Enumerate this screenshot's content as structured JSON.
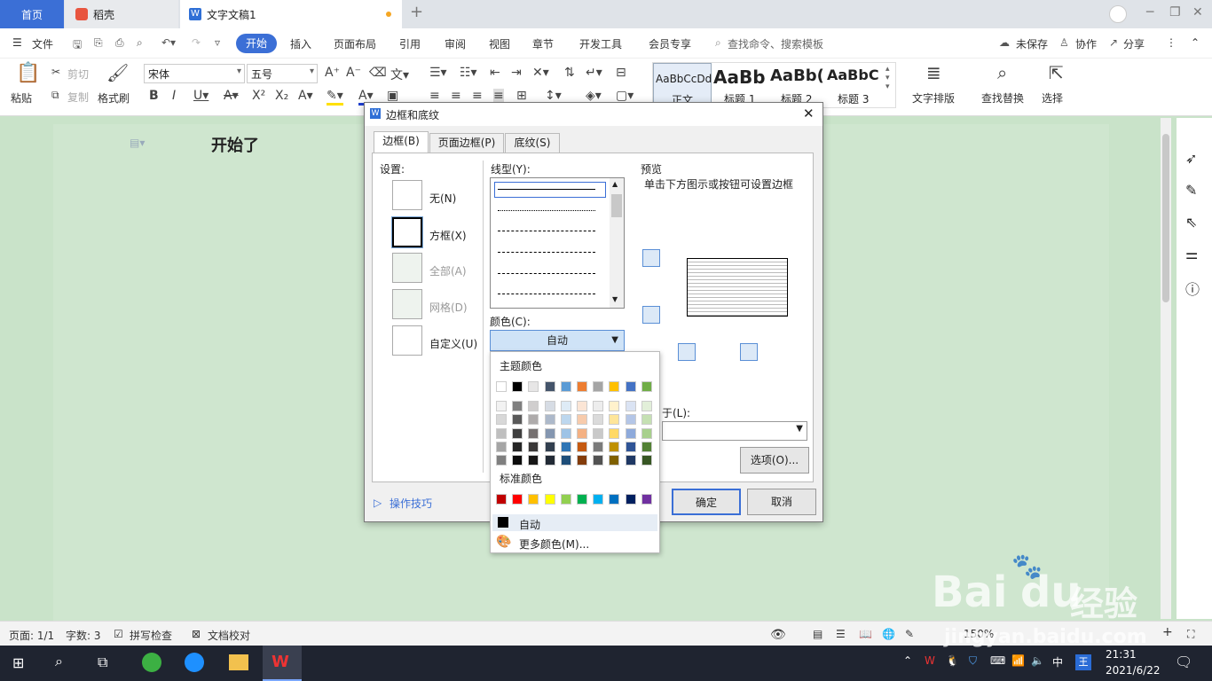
{
  "titlebar": {
    "tab_home": "首页",
    "tab_daoke": "稻壳",
    "tab_doc": "文字文稿1"
  },
  "menubar": {
    "items": [
      "文件",
      "开始",
      "插入",
      "页面布局",
      "引用",
      "审阅",
      "视图",
      "章节",
      "开发工具",
      "会员专享"
    ],
    "search_placeholder": "查找命令、搜索模板",
    "unsaved": "未保存",
    "collab": "协作",
    "share": "分享"
  },
  "ribbon": {
    "paste": "粘贴",
    "cut": "剪切",
    "copy": "复制",
    "format_painter": "格式刷",
    "font_name": "宋体",
    "font_size": "五号",
    "styles": [
      {
        "preview": "AaBbCcDd",
        "label": "正文"
      },
      {
        "preview": "AaBb",
        "label": "标题 1"
      },
      {
        "preview": "AaBb(",
        "label": "标题 2"
      },
      {
        "preview": "AaBbC",
        "label": "标题 3"
      }
    ],
    "text_layout": "文字排版",
    "find_replace": "查找替换",
    "select": "选择"
  },
  "document": {
    "text": "开始了"
  },
  "dialog": {
    "title": "边框和底纹",
    "tabs": [
      "边框(B)",
      "页面边框(P)",
      "底纹(S)"
    ],
    "settings_label": "设置:",
    "settings": [
      "无(N)",
      "方框(X)",
      "全部(A)",
      "网格(D)",
      "自定义(U)"
    ],
    "line_style_label": "线型(Y):",
    "color_label": "颜色(C):",
    "color_value": "自动",
    "preview_label": "预览",
    "preview_hint": "单击下方图示或按钮可设置边框",
    "apply_label": "于(L):",
    "options_button": "选项(O)...",
    "tips": "操作技巧",
    "ok": "确定",
    "cancel": "取消"
  },
  "color_popup": {
    "theme_label": "主题颜色",
    "standard_label": "标准颜色",
    "auto": "自动",
    "more": "更多颜色(M)...",
    "theme_top": [
      "#ffffff",
      "#000000",
      "#e7e6e6",
      "#44546a",
      "#5b9bd5",
      "#ed7d31",
      "#a5a5a5",
      "#ffc000",
      "#4472c4",
      "#70ad47"
    ],
    "theme_shades": [
      [
        "#f2f2f2",
        "#7f7f7f",
        "#d0cece",
        "#d6dce4",
        "#deebf6",
        "#fbe5d5",
        "#ededed",
        "#fff2cc",
        "#dae3f3",
        "#e2efd9"
      ],
      [
        "#d8d8d8",
        "#595959",
        "#aeabab",
        "#adb9ca",
        "#bdd7ee",
        "#f7cbac",
        "#dbdbdb",
        "#fee599",
        "#b4c6e7",
        "#c5e0b3"
      ],
      [
        "#bfbfbf",
        "#3f3f3f",
        "#757070",
        "#8496b0",
        "#9dc3e6",
        "#f4b183",
        "#c9c9c9",
        "#ffd965",
        "#8eaadb",
        "#a8d08d"
      ],
      [
        "#a5a5a5",
        "#262626",
        "#3a3838",
        "#323f4f",
        "#2e75b5",
        "#c55a11",
        "#7b7b7b",
        "#bf9000",
        "#2f5496",
        "#538135"
      ],
      [
        "#7f7f7f",
        "#0c0c0c",
        "#171616",
        "#222a35",
        "#1e4e79",
        "#833c0b",
        "#525252",
        "#7f6000",
        "#1f3864",
        "#375623"
      ]
    ],
    "standard": [
      "#c00000",
      "#ff0000",
      "#ffc000",
      "#ffff00",
      "#92d050",
      "#00b050",
      "#00b0f0",
      "#0070c0",
      "#002060",
      "#7030a0"
    ]
  },
  "statusbar": {
    "page": "页面: 1/1",
    "words": "字数: 3",
    "spell": "拼写检查",
    "proof": "文档校对",
    "zoom": "150%"
  },
  "taskbar": {
    "time": "21:31",
    "date": "2021/6/22",
    "ime": "中"
  },
  "watermark": {
    "brand": "Bai",
    "brand2": "du",
    "cn": "经验",
    "url": "jingyan.baidu.com"
  }
}
